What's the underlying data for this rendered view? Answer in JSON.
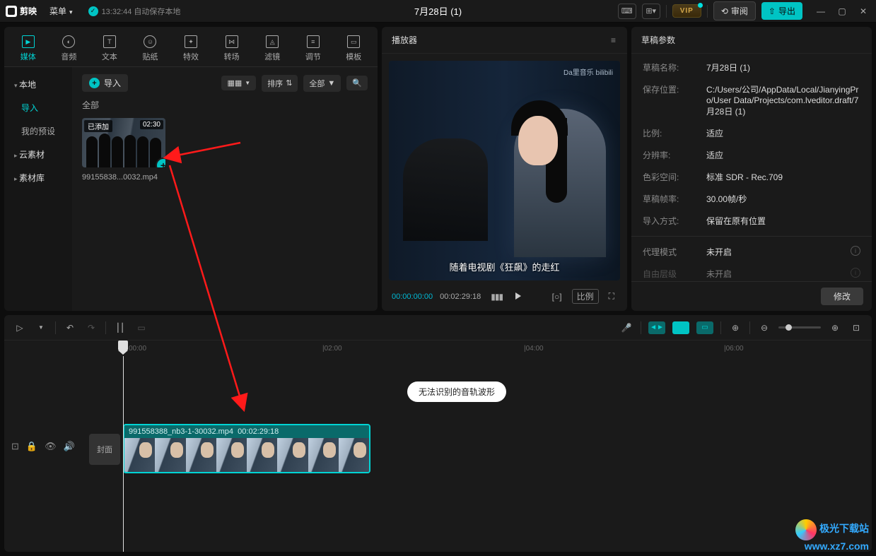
{
  "app": {
    "name": "剪映",
    "menu": "菜单",
    "save_status": "13:32:44 自动保存本地",
    "doc_title": "7月28日 (1)"
  },
  "title_right": {
    "review": "审阅",
    "export": "导出"
  },
  "win": {
    "min": "—",
    "max": "▢",
    "close": "✕"
  },
  "categories": [
    "媒体",
    "音频",
    "文本",
    "贴纸",
    "特效",
    "转场",
    "滤镜",
    "调节",
    "模板"
  ],
  "sidebar": {
    "local": "本地",
    "import": "导入",
    "presets": "我的预设",
    "cloud": "云素材",
    "library": "素材库"
  },
  "media_toolbar": {
    "import": "导入",
    "view": "▦▦",
    "sort": "排序",
    "all": "全部"
  },
  "media_section": "全部",
  "thumb": {
    "added": "已添加",
    "duration": "02:30",
    "name": "99155838...0032.mp4"
  },
  "player": {
    "title": "播放器",
    "watermark": "Da里音乐  bilibili",
    "caption": "随着电视剧《狂飙》的走红",
    "t1": "00:00:00:00",
    "t2": "00:02:29:18",
    "ratio": "比例"
  },
  "props": {
    "title": "草稿参数",
    "rows": {
      "name_l": "草稿名称:",
      "name_v": "7月28日 (1)",
      "save_l": "保存位置:",
      "save_v": "C:/Users/公司/AppData/Local/JianyingPro/User Data/Projects/com.lveditor.draft/7月28日 (1)",
      "ratio_l": "比例:",
      "ratio_v": "适应",
      "res_l": "分辨率:",
      "res_v": "适应",
      "color_l": "色彩空间:",
      "color_v": "标准 SDR - Rec.709",
      "fps_l": "草稿帧率:",
      "fps_v": "30.00帧/秒",
      "imp_l": "导入方式:",
      "imp_v": "保留在原有位置",
      "proxy_l": "代理模式",
      "proxy_v": "未开启",
      "free_l": "自由层级",
      "free_v": "未开启"
    },
    "edit": "修改"
  },
  "timeline": {
    "ticks": {
      "t0": "00:00",
      "t2": "|02:00",
      "t4": "|04:00",
      "t6": "|06:00"
    },
    "bubble": "无法识别的音轨波形",
    "cover": "封面",
    "clip_name": "991558388_nb3-1-30032.mp4",
    "clip_dur": "00:02:29:18"
  },
  "watermark": {
    "l1": "极光下载站",
    "l2": "www.xz7.com"
  },
  "vip": "VIP"
}
